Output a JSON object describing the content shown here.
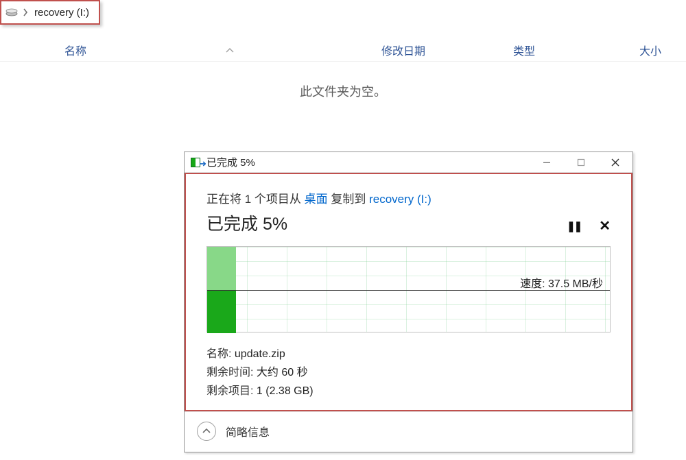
{
  "breadcrumb": {
    "path": "recovery (I:)"
  },
  "columns": {
    "name": "名称",
    "date": "修改日期",
    "type": "类型",
    "size": "大小"
  },
  "empty_folder_text": "此文件夹为空。",
  "dialog": {
    "title": "已完成 5%",
    "copy_line_prefix": "正在将 1 个项目从 ",
    "source": "桌面",
    "copy_line_mid": " 复制到 ",
    "destination": "recovery (I:)",
    "status": "已完成 5%",
    "pause_icon": "❚❚",
    "cancel_icon": "✕",
    "speed_label": "速度: 37.5 MB/秒",
    "details": {
      "name_label": "名称: ",
      "name_value": "update.zip",
      "time_label": "剩余时间: ",
      "time_value": "大约 60 秒",
      "items_label": "剩余项目: ",
      "items_value": "1 (2.38 GB)"
    },
    "footer_label": "简略信息"
  },
  "chart_data": {
    "type": "bar",
    "progress_percent": 5,
    "speed_value": 37.5,
    "speed_unit": "MB/秒",
    "bar_segments": [
      {
        "name": "light",
        "color": "#88d888"
      },
      {
        "name": "dark",
        "color": "#1aa81a"
      }
    ]
  }
}
